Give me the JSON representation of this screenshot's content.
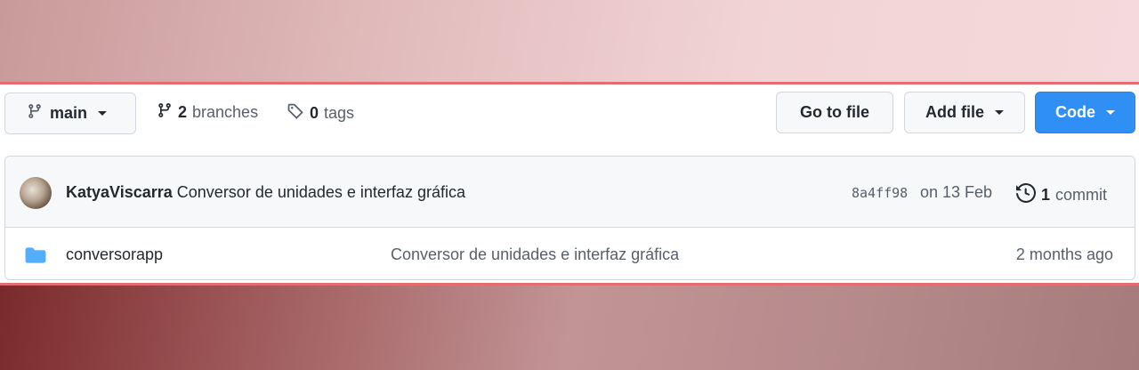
{
  "toolbar": {
    "branch": "main",
    "branches_count": "2",
    "branches_label": "branches",
    "tags_count": "0",
    "tags_label": "tags",
    "goto_label": "Go to file",
    "addfile_label": "Add file",
    "code_label": "Code"
  },
  "latest_commit": {
    "author": "KatyaViscarra",
    "message": "Conversor de unidades e interfaz gráfica",
    "sha": "8a4ff98",
    "date": "on 13 Feb",
    "count": "1",
    "count_label": "commit"
  },
  "files": [
    {
      "name": "conversorapp",
      "type": "folder",
      "message": "Conversor de unidades e interfaz gráfica",
      "age": "2 months ago"
    }
  ],
  "colors": {
    "accent_frame": "#e56c70",
    "code_button": "#2f8ff5",
    "folder_icon": "#54aeff"
  }
}
